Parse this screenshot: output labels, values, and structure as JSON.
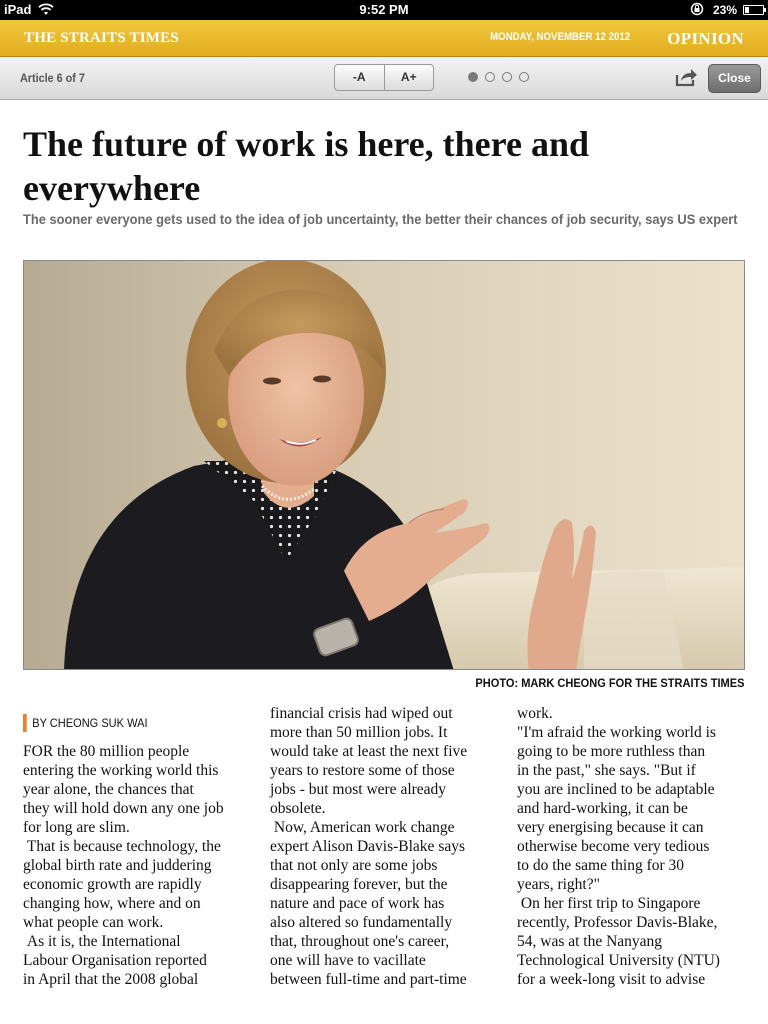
{
  "status_bar": {
    "device": "iPad",
    "time": "9:52 PM",
    "battery": "23%"
  },
  "masthead": {
    "logo": "THE STRAITS TIMES",
    "date": "MONDAY, NOVEMBER 12 2012",
    "section": "OPINION",
    "color": "#e8b82c"
  },
  "toolbar": {
    "article_counter": "Article 6 of 7",
    "font_decrease": "-A",
    "font_increase": "A+",
    "page_dots": 4,
    "active_dot": 1,
    "close_label": "Close"
  },
  "article": {
    "headline": "The future of work is here, there and everywhere",
    "standfirst": "The sooner everyone gets used to the idea of job uncertainty, the better their chances of job security, says US expert",
    "photo_credit": "PHOTO: MARK CHEONG FOR THE STRAITS TIMES",
    "byline": "BY CHEONG SUK WAI",
    "columns": [
      "FOR the 80 million people\nentering the working world this\nyear alone, the chances that\nthey will hold down any one job\nfor long are slim.\n That is because technology, the\nglobal birth rate and juddering\neconomic growth are rapidly\nchanging how, where and on\nwhat people can work.\n As it is, the International\nLabour Organisation reported\nin April that the 2008 global",
      "financial crisis had wiped out\nmore than 50 million jobs. It\nwould take at least the next five\nyears to restore some of those\njobs - but most were already\nobsolete.\n Now, American work change\nexpert Alison Davis-Blake says\nthat not only are some jobs\ndisappearing forever, but the\nnature and pace of work has\nalso altered so fundamentally\nthat, throughout one's career,\none will have to vacillate\nbetween full-time and part-time",
      "work.\n\"I'm afraid the working world is\ngoing to be more ruthless than\nin the past,\" she says. \"But if\nyou are inclined to be adaptable\nand hard-working, it can be\nvery energising because it can\notherwise become very tedious\nto do the same thing for 30\nyears, right?\"\n On her first trip to Singapore\nrecently, Professor Davis-Blake,\n54, was at the Nanyang\nTechnological University (NTU)\nfor a week-long visit to advise"
    ]
  }
}
